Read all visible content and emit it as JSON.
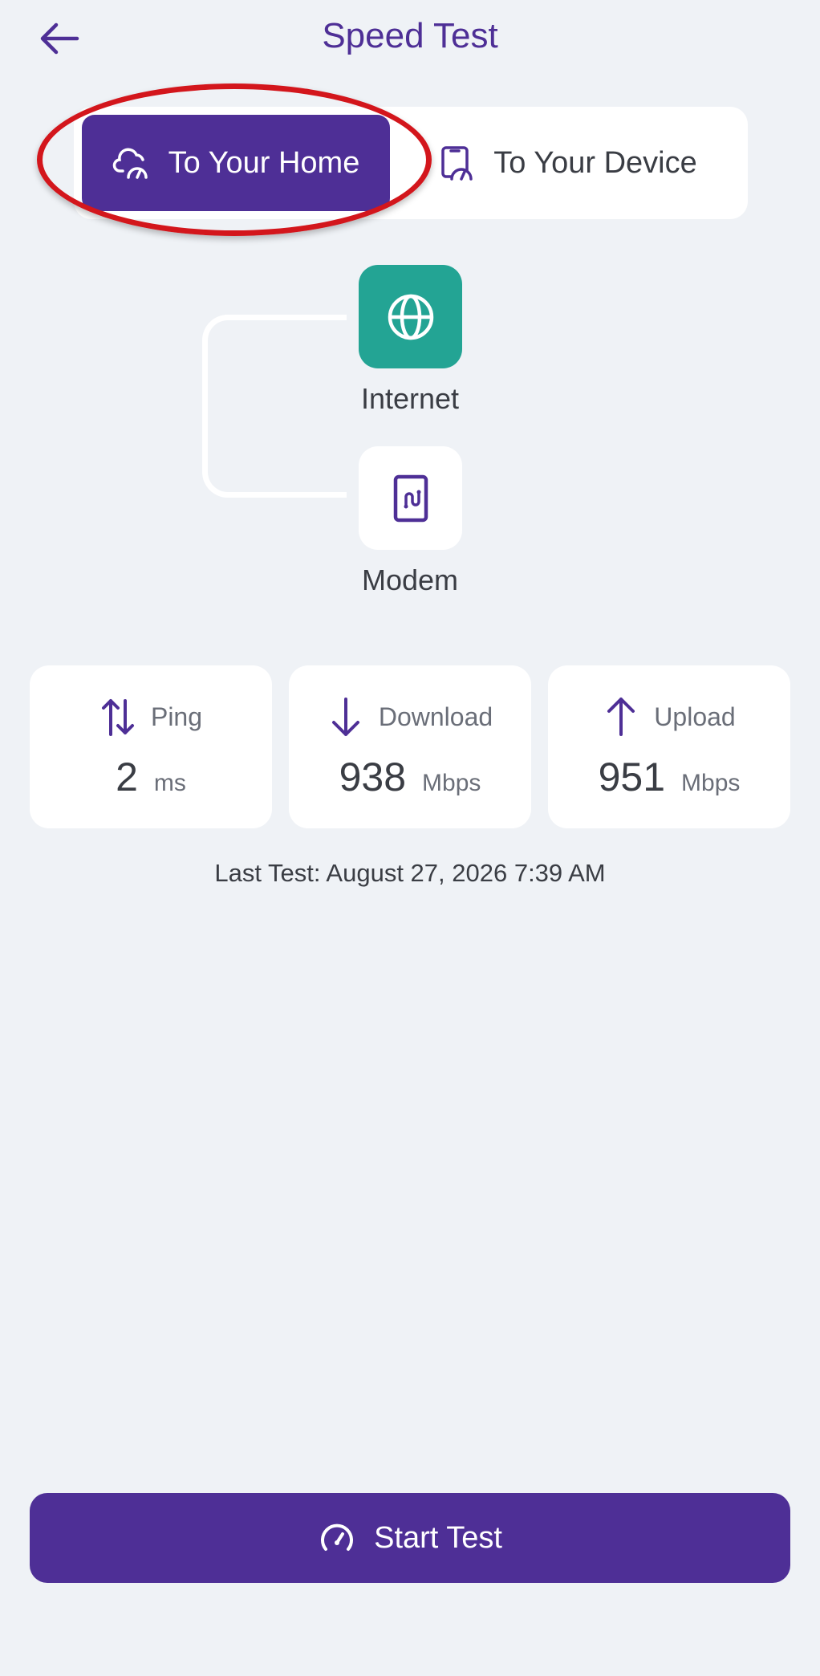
{
  "header": {
    "title": "Speed Test",
    "back_icon": "arrow-left-icon"
  },
  "toggle": {
    "home_label": "To Your Home",
    "device_label": "To Your Device",
    "active": "home",
    "home_icon": "cloud-speedometer-icon",
    "device_icon": "device-speedometer-icon"
  },
  "diagram": {
    "internet_label": "Internet",
    "modem_label": "Modem",
    "internet_icon": "globe-icon",
    "modem_icon": "modem-icon"
  },
  "stats": {
    "ping": {
      "label": "Ping",
      "value": "2",
      "unit": "ms",
      "icon": "up-down-arrows-icon"
    },
    "download": {
      "label": "Download",
      "value": "938",
      "unit": "Mbps",
      "icon": "arrow-down-icon"
    },
    "upload": {
      "label": "Upload",
      "value": "951",
      "unit": "Mbps",
      "icon": "arrow-up-icon"
    }
  },
  "last_test": "Last Test: August 27, 2026 7:39 AM",
  "start_button": {
    "label": "Start Test",
    "icon": "speedometer-icon"
  },
  "colors": {
    "primary": "#4e2f96",
    "teal": "#23a494",
    "background": "#eff2f6",
    "highlight": "#d3161c"
  }
}
